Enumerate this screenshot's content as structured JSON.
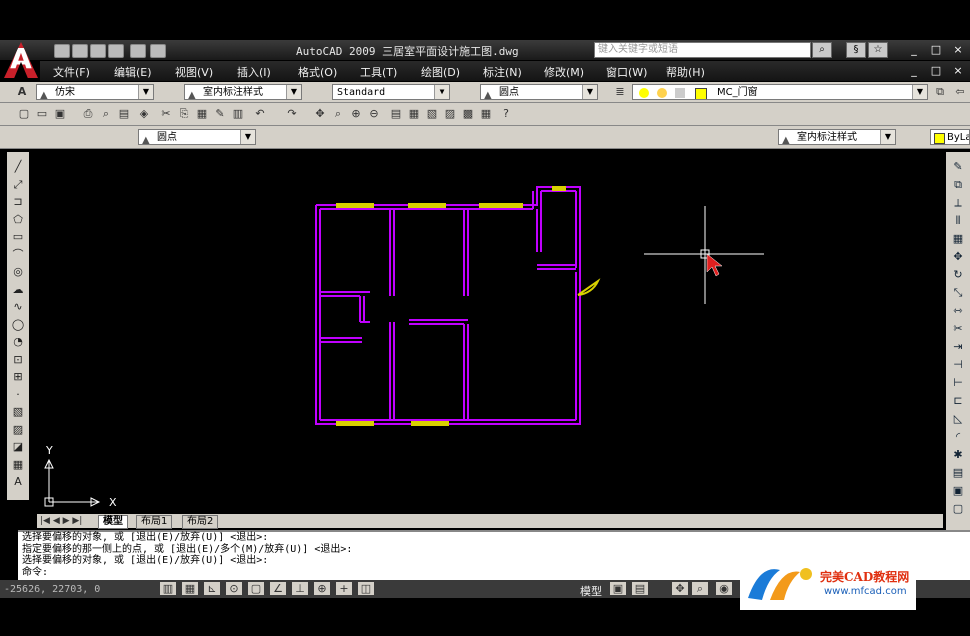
{
  "title_bar": {
    "app_title": "AutoCAD 2009  三居室平面设计施工图.dwg",
    "search_placeholder": "键入关键字或短语",
    "window_controls": [
      "_",
      "□",
      "×"
    ]
  },
  "menu": [
    "文件(F)",
    "编辑(E)",
    "视图(V)",
    "插入(I)",
    "格式(O)",
    "工具(T)",
    "绘图(D)",
    "标注(N)",
    "修改(M)",
    "窗口(W)",
    "帮助(H)"
  ],
  "toolbar1": {
    "font_style": "仿宋",
    "dim_style": "室内标注样式",
    "table_style": "Standard",
    "layer_combo": "圆点",
    "current_layer": "MC_门窗"
  },
  "toolbar3": {
    "layer_combo": "圆点",
    "dim_style": "室内标注样式",
    "linetype": "ByLa"
  },
  "layout_tabs": [
    "模型",
    "布局1",
    "布局2"
  ],
  "command_lines": [
    "选择要偏移的对象, 或 [退出(E)/放弃(U)] <退出>:",
    "指定要偏移的那一侧上的点, 或 [退出(E)/多个(M)/放弃(U)] <退出>:",
    "选择要偏移的对象, 或 [退出(E)/放弃(U)] <退出>:",
    "命令:"
  ],
  "status": {
    "coords": "-25626, 22703, 0",
    "model_label": "模型"
  },
  "ucs": {
    "y_label": "Y",
    "x_label": "X"
  },
  "watermark": {
    "brand": "完美CAD教程网",
    "url": "www.mfcad.com"
  },
  "colors": {
    "wall": "#c000ff",
    "window": "#d8d000",
    "canvas": "#000000",
    "crosshair": "#ffffff",
    "cursor": "#e02020"
  }
}
